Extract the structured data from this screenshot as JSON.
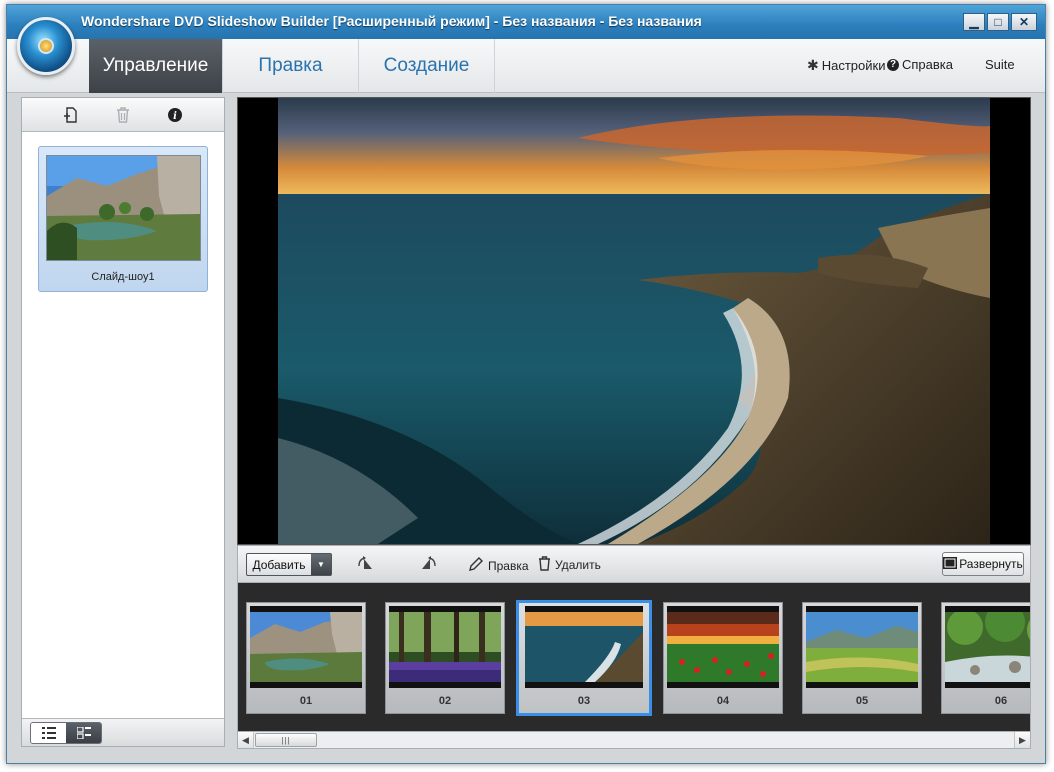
{
  "window": {
    "title": "Wondershare DVD Slideshow Builder [Расширенный режим] - Без названия - Без названия",
    "controls": {
      "minimize": "▁",
      "maximize": "□",
      "close": "✕"
    }
  },
  "menubar": {
    "tabs": [
      {
        "label": "Управление",
        "active": true
      },
      {
        "label": "Правка",
        "active": false
      },
      {
        "label": "Создание",
        "active": false
      }
    ],
    "settings_label": "Настройки",
    "help_label": "Справка",
    "suite_label": "Suite"
  },
  "left_panel": {
    "toolbar_icons": [
      "add-file-icon",
      "trash-icon",
      "info-icon"
    ],
    "slideshows": [
      {
        "label": "Слайд-шоу1"
      }
    ],
    "view_modes": [
      "list-view-icon",
      "thumbnail-view-icon"
    ]
  },
  "edit_bar": {
    "add_label": "Добавить",
    "rotate_left_icon": "rotate-left-icon",
    "rotate_right_icon": "rotate-right-icon",
    "edit_label": "Правка",
    "delete_label": "Удалить",
    "expand_label": "Развернуть"
  },
  "filmstrip": {
    "slides": [
      {
        "number": "01",
        "scene": "river-canyon"
      },
      {
        "number": "02",
        "scene": "forest-bluebells"
      },
      {
        "number": "03",
        "scene": "coast-sunset",
        "selected": true
      },
      {
        "number": "04",
        "scene": "poppy-field-sunset"
      },
      {
        "number": "05",
        "scene": "green-valley"
      },
      {
        "number": "06",
        "scene": "forest-stream"
      }
    ]
  },
  "colors": {
    "titlebar": "#2b7fbd",
    "active_tab": "#3d4248",
    "tab_text": "#2a73ad",
    "selection": "#3a8ee6"
  }
}
